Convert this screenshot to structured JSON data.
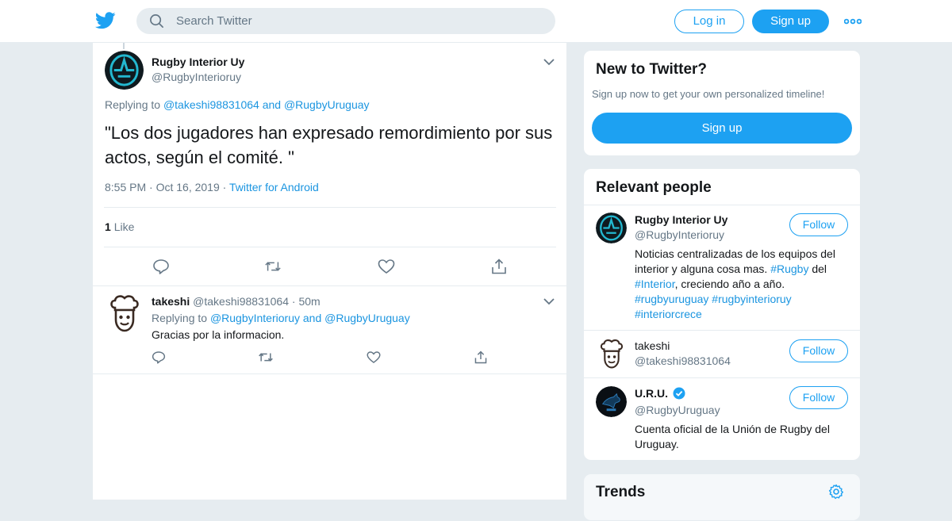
{
  "header": {
    "search_placeholder": "Search Twitter",
    "login_label": "Log in",
    "signup_label": "Sign up"
  },
  "tweet": {
    "name": "Rugby Interior Uy",
    "handle": "@RugbyInterioruy",
    "replying_prefix": "Replying to",
    "replying_user1": "@takeshi98831064",
    "replying_and": "and",
    "replying_user2": "@RugbyUruguay",
    "text": "\"Los dos jugadores han expresado remordimiento por sus actos, según el comité. \"",
    "time": "8:55 PM",
    "date": "Oct 16, 2019",
    "source": "Twitter for Android",
    "like_count": "1",
    "like_label": "Like"
  },
  "reply": {
    "name": "takeshi",
    "handle": "@takeshi98831064",
    "age": "50m",
    "replying_prefix": "Replying to",
    "replying_user1": "@RugbyInterioruy",
    "replying_and": "and",
    "replying_user2": "@RugbyUruguay",
    "text": "Gracias por la informacion."
  },
  "new_to_twitter": {
    "title": "New to Twitter?",
    "subtitle": "Sign up now to get your own personalized timeline!",
    "signup_label": "Sign up"
  },
  "relevant_people": {
    "title": "Relevant people",
    "follow_label": "Follow",
    "people": [
      {
        "name": "Rugby Interior Uy",
        "handle": "@RugbyInterioruy",
        "bio_1": "Noticias centralizadas de los equipos del interior y alguna cosa mas.",
        "bio_tag1": "#Rugby",
        "bio_2": "del",
        "bio_tag2": "#Interior",
        "bio_3": ", creciendo año a año.",
        "bio_tag3": "#rugbyuruguay",
        "bio_tag4": "#rugbyinterioruy",
        "bio_tag5": "#interiorcrece"
      },
      {
        "name": "takeshi",
        "handle": "@takeshi98831064"
      },
      {
        "name": "U.R.U.",
        "handle": "@RugbyUruguay",
        "verified": true,
        "bio": "Cuenta oficial de la Unión de Rugby del Uruguay."
      }
    ]
  },
  "trends": {
    "title": "Trends"
  },
  "colors": {
    "accent": "#1da1f2",
    "link": "#1b95e0",
    "muted": "#657786",
    "background": "#e6ecf0"
  },
  "icons": [
    "twitter-bird-icon",
    "search-icon",
    "more-icon",
    "chevron-down-icon",
    "reply-icon",
    "retweet-icon",
    "like-icon",
    "share-icon",
    "verified-icon",
    "gear-icon"
  ]
}
